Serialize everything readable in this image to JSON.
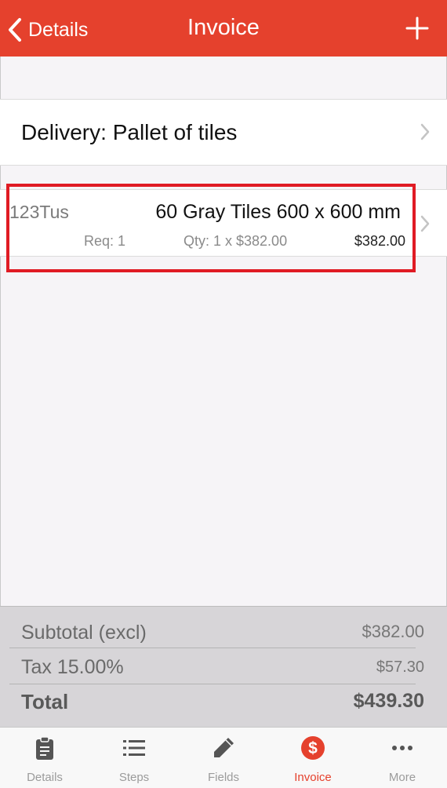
{
  "navbar": {
    "back_label": "Details",
    "title": "Invoice",
    "add_icon": "plus-icon",
    "color": "#e5412d"
  },
  "delivery": {
    "label": "Delivery: Pallet of tiles"
  },
  "line_item": {
    "code": "123Tus",
    "description": "60 Gray Tiles 600 x 600 mm",
    "req": "Req: 1",
    "qty": "Qty: 1 x $382.00",
    "amount": "$382.00",
    "highlight_color": "#e01b24"
  },
  "summary": {
    "subtotal_label": "Subtotal (excl)",
    "subtotal_value": "$382.00",
    "tax_label": "Tax 15.00%",
    "tax_value": "$57.30",
    "total_label": "Total",
    "total_value": "$439.30"
  },
  "tabbar": {
    "active_color": "#e5412d",
    "tabs": [
      {
        "label": "Details",
        "icon": "clipboard-icon"
      },
      {
        "label": "Steps",
        "icon": "list-icon"
      },
      {
        "label": "Fields",
        "icon": "pencil-icon"
      },
      {
        "label": "Invoice",
        "icon": "dollar-circle-icon",
        "active": true
      },
      {
        "label": "More",
        "icon": "more-dots-icon"
      }
    ]
  }
}
